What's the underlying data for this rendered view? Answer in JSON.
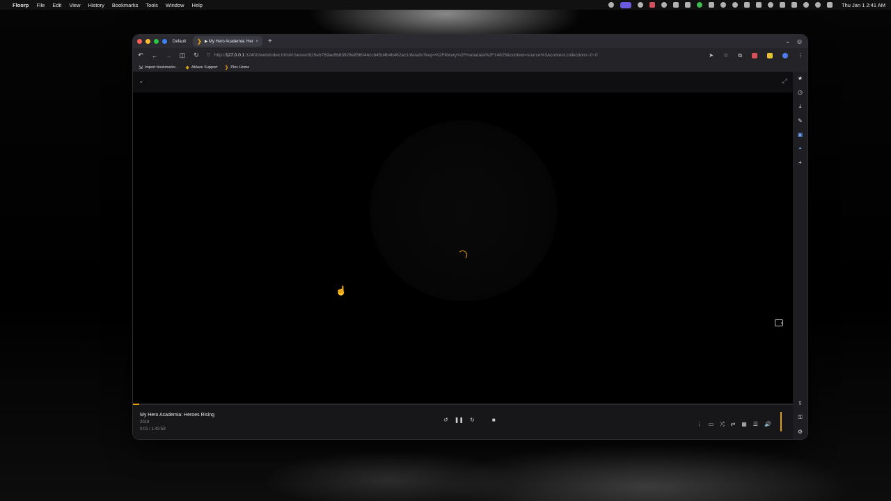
{
  "menubar": {
    "apple": "",
    "app_name": "Floorp",
    "items": [
      "File",
      "Edit",
      "View",
      "History",
      "Bookmarks",
      "Tools",
      "Window",
      "Help"
    ],
    "clock": "Thu Jan 1  2:41 AM"
  },
  "browser": {
    "workspace": "Default",
    "tab": {
      "icon": "❯",
      "title": "▶ My Hero Academia: Heroes R",
      "close": "×"
    },
    "new_tab": "+",
    "url": {
      "scheme": "http://",
      "host": "127.0.0.1",
      "rest": ":32400/web/index.html#!/server/b25eb769ae5b83928e856044ccb45d4b4b462ac1/details?key=%2Flibrary%2Fmetadata%2F14825&context=source%3Acontent.collections~0~0"
    },
    "bookmarks": [
      {
        "icon": "⇲",
        "label": "Import bookmarks..."
      },
      {
        "icon": "◆",
        "label": "Ablaze Support"
      },
      {
        "icon": "❯",
        "label": "Plex Home"
      }
    ]
  },
  "player": {
    "title": "My Hero Academia: Heroes Rising",
    "year": "2019",
    "time": "0:01 / 1:43:59",
    "progress": 0.003,
    "accent": "#e5a00d"
  },
  "icons": {
    "back": "↶",
    "forward": "→",
    "reload": "↻",
    "reader": "◫",
    "shield": "⛉",
    "share": "➤",
    "star": "☆",
    "collapse": "⌄",
    "fullscreen": "⤢",
    "replay": "↺",
    "pause": "❚❚",
    "skip": "↻",
    "stop": "■",
    "more": "⋮",
    "screen": "▭",
    "shuffle": "⤮",
    "adjust": "⇄",
    "grid": "▦",
    "queue": "☰",
    "volume": "🔊",
    "sb_star": "★",
    "sb_history": "◷",
    "sb_download": "⤓",
    "sb_notes": "✎",
    "sb_translate": "▣",
    "sb_ext": "◓",
    "sb_add": "+",
    "sb_send": "⇪",
    "sb_key": "⚿",
    "sb_settings": "⚙",
    "cursor": "☝"
  }
}
